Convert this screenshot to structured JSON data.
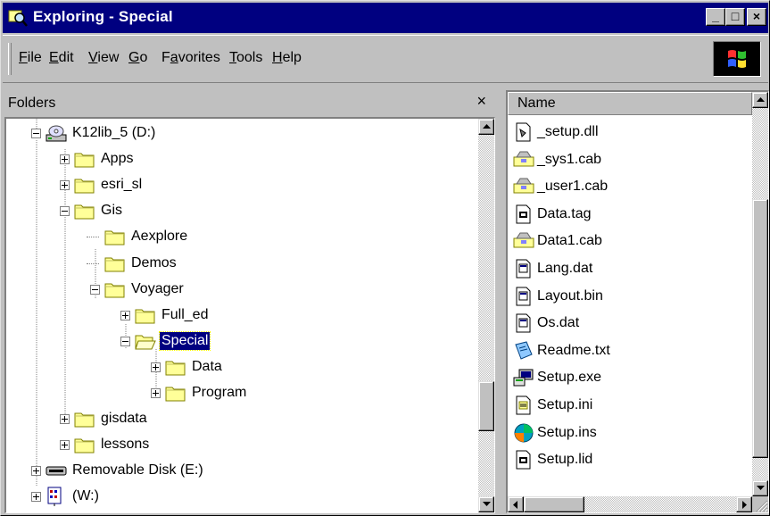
{
  "window": {
    "title": "Exploring - Special"
  },
  "titlebar_buttons": {
    "minimize": "_",
    "maximize": "□",
    "close": "×"
  },
  "menu": [
    {
      "pre": "",
      "ul": "F",
      "post": "ile"
    },
    {
      "pre": "",
      "ul": "E",
      "post": "dit"
    },
    {
      "pre": "",
      "ul": "V",
      "post": "iew"
    },
    {
      "pre": "",
      "ul": "G",
      "post": "o"
    },
    {
      "pre": "F",
      "ul": "a",
      "post": "vorites"
    },
    {
      "pre": "",
      "ul": "T",
      "post": "ools"
    },
    {
      "pre": "",
      "ul": "H",
      "post": "elp"
    }
  ],
  "folders_pane": {
    "title": "Folders",
    "close": "×"
  },
  "tree": [
    {
      "label": "K12lib_5 (D:)",
      "icon": "cd-drive-icon",
      "expander": "minus"
    },
    {
      "label": "Apps",
      "icon": "folder-icon",
      "expander": "plus"
    },
    {
      "label": "esri_sl",
      "icon": "folder-icon",
      "expander": "plus"
    },
    {
      "label": "Gis",
      "icon": "folder-icon",
      "expander": "minus"
    },
    {
      "label": "Aexplore",
      "icon": "folder-icon",
      "expander": ""
    },
    {
      "label": "Demos",
      "icon": "folder-icon",
      "expander": ""
    },
    {
      "label": "Voyager",
      "icon": "folder-icon",
      "expander": "minus"
    },
    {
      "label": "Full_ed",
      "icon": "folder-icon",
      "expander": "plus"
    },
    {
      "label": "Special",
      "icon": "folder-open-icon",
      "expander": "minus",
      "selected": true
    },
    {
      "label": "Data",
      "icon": "folder-icon",
      "expander": "plus"
    },
    {
      "label": "Program",
      "icon": "folder-icon",
      "expander": "plus"
    },
    {
      "label": "gisdata",
      "icon": "folder-icon",
      "expander": "plus"
    },
    {
      "label": "lessons",
      "icon": "folder-icon",
      "expander": "plus"
    },
    {
      "label": "Removable Disk (E:)",
      "icon": "removable-disk-icon",
      "expander": "plus"
    },
    {
      "label": "(W:)",
      "icon": "network-drive-icon",
      "expander": "plus"
    }
  ],
  "list": {
    "column_header": "Name",
    "files": [
      {
        "name": "_setup.dll",
        "icon": "dll-icon"
      },
      {
        "name": "_sys1.cab",
        "icon": "cab-icon"
      },
      {
        "name": "_user1.cab",
        "icon": "cab-icon"
      },
      {
        "name": "Data.tag",
        "icon": "generic-file-icon"
      },
      {
        "name": "Data1.cab",
        "icon": "cab-icon"
      },
      {
        "name": "Lang.dat",
        "icon": "dat-icon"
      },
      {
        "name": "Layout.bin",
        "icon": "dat-icon"
      },
      {
        "name": "Os.dat",
        "icon": "dat-icon"
      },
      {
        "name": "Readme.txt",
        "icon": "text-file-icon"
      },
      {
        "name": "Setup.exe",
        "icon": "setup-exe-icon"
      },
      {
        "name": "Setup.ini",
        "icon": "ini-file-icon"
      },
      {
        "name": "Setup.ins",
        "icon": "install-script-icon"
      },
      {
        "name": "Setup.lid",
        "icon": "generic-file-icon"
      }
    ]
  },
  "colors": {
    "titlebar": "#000080",
    "face": "#c0c0c0",
    "selection": "#000080",
    "folder": "#ffff99"
  }
}
